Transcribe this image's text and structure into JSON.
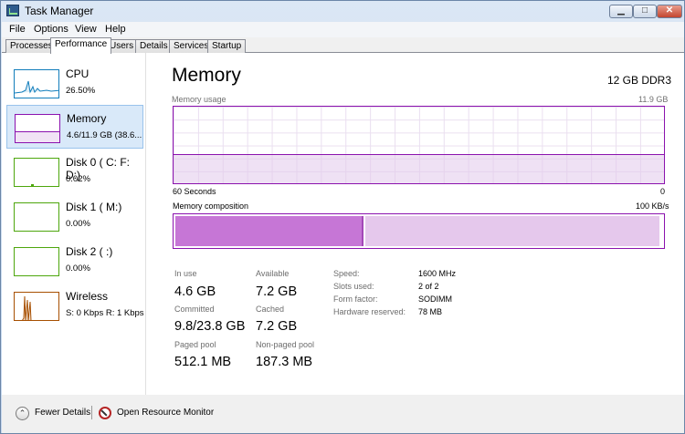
{
  "window": {
    "title": "Task Manager",
    "controls": {
      "minimize": "▁",
      "maximize": "□",
      "close": "✕"
    }
  },
  "menu": [
    "File",
    "Options",
    "View",
    "Help"
  ],
  "tabs": [
    "Processes",
    "Performance",
    "Users",
    "Details",
    "Services",
    "Startup"
  ],
  "active_tab": "Performance",
  "sidebar": {
    "items": [
      {
        "name": "CPU",
        "value": "26.50%",
        "color": "#117dbb"
      },
      {
        "name": "Memory",
        "value": "4.6/11.9 GB (38.6...",
        "color": "#8b12ae"
      },
      {
        "name": "Disk 0 ( C: F: D:)",
        "value": "0.02%",
        "color": "#4da60c"
      },
      {
        "name": "Disk 1 ( M:)",
        "value": "0.00%",
        "color": "#4da60c"
      },
      {
        "name": "Disk 2 ( :)",
        "value": "0.00%",
        "color": "#4da60c"
      },
      {
        "name": "Wireless",
        "value": "S: 0 Kbps R: 1 Kbps",
        "color": "#a74f01"
      }
    ]
  },
  "main": {
    "title": "Memory",
    "memory_type": "12 GB DDR3",
    "usage": {
      "label": "Memory usage",
      "max": "11.9 GB",
      "time_span": "60 Seconds",
      "time_end": "0",
      "level_fraction": 0.386
    },
    "composition": {
      "label": "Memory composition",
      "rate": "100 KB/s",
      "in_use_fraction": 0.386,
      "cached_fraction": 0.605
    },
    "stats": {
      "in_use": {
        "label": "In use",
        "value": "4.6 GB"
      },
      "available": {
        "label": "Available",
        "value": "7.2 GB"
      },
      "committed": {
        "label": "Committed",
        "value": "9.8/23.8 GB"
      },
      "cached": {
        "label": "Cached",
        "value": "7.2 GB"
      },
      "paged_pool": {
        "label": "Paged pool",
        "value": "512.1 MB"
      },
      "non_paged_pool": {
        "label": "Non-paged pool",
        "value": "187.3 MB"
      }
    },
    "hardware": [
      {
        "label": "Speed:",
        "value": "1600 MHz"
      },
      {
        "label": "Slots used:",
        "value": "2 of 2"
      },
      {
        "label": "Form factor:",
        "value": "SODIMM"
      },
      {
        "label": "Hardware reserved:",
        "value": "78 MB"
      }
    ]
  },
  "footer": {
    "fewer_details": "Fewer Details",
    "resource_monitor": "Open Resource Monitor"
  }
}
